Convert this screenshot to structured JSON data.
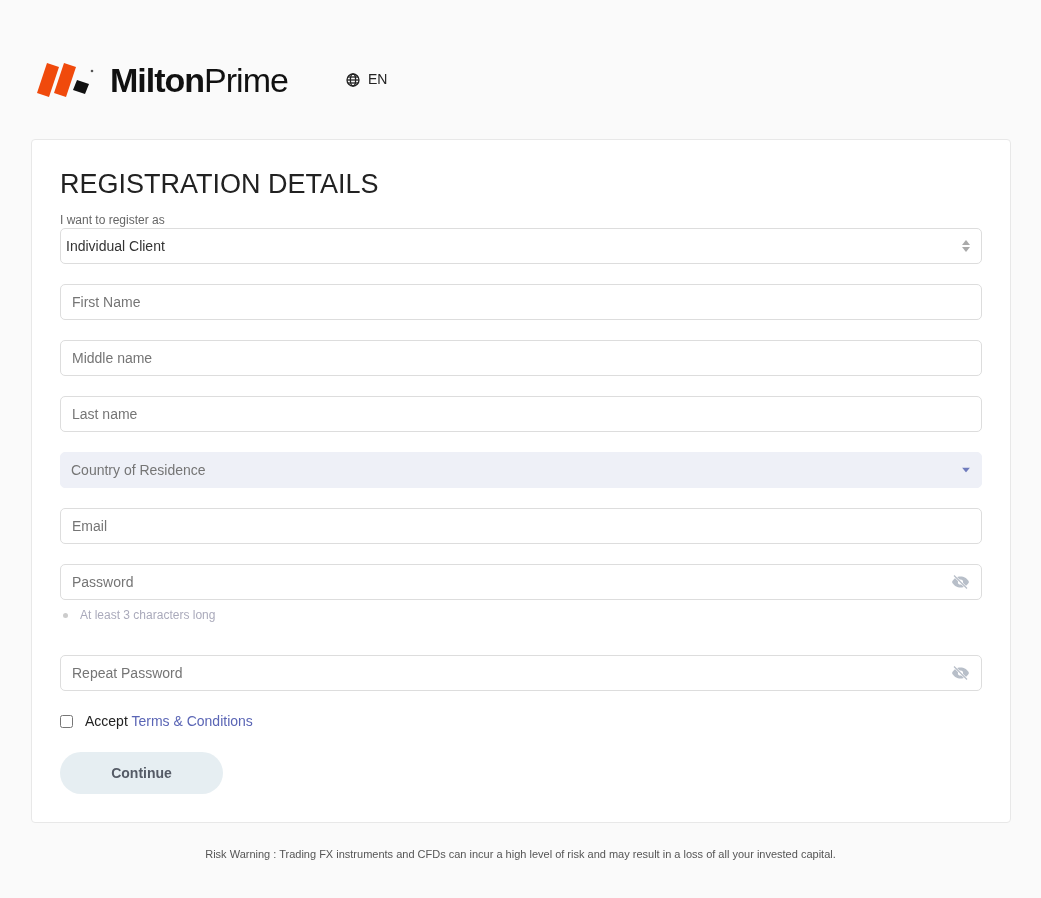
{
  "header": {
    "logo": "**Milton**Prime",
    "language": "EN"
  },
  "form": {
    "title": "REGISTRATION DETAILS",
    "fields": [
      {
        "kind": "select",
        "label": "I want to register as",
        "value": "Individual Client"
      },
      {
        "kind": "text",
        "placeholder": "First Name"
      },
      {
        "kind": "text",
        "placeholder": "Middle name"
      },
      {
        "kind": "text",
        "placeholder": "Last name"
      },
      {
        "kind": "dropdown",
        "placeholder": "Country of Residence"
      },
      {
        "kind": "text",
        "placeholder": "Email"
      },
      {
        "kind": "password",
        "placeholder": "Password",
        "hint": "At least 3 characters long"
      },
      {
        "kind": "password",
        "placeholder": "Repeat Password"
      }
    ],
    "terms": {
      "checked": false,
      "text": "Accept",
      "link": "Terms & Conditions"
    },
    "submit": "Continue"
  },
  "footer": "Risk Warning : Trading FX instruments and CFDs can incur a high level of risk and may result in a loss of all your invested capital."
}
